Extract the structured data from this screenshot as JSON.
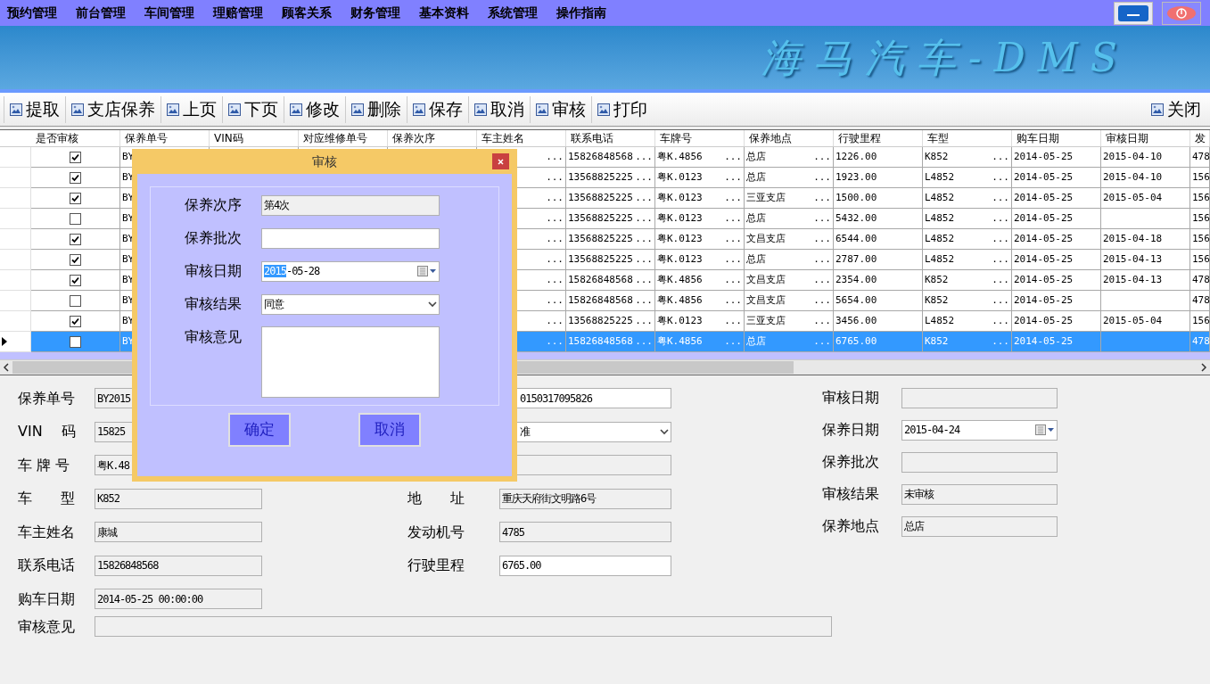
{
  "menu": [
    {
      "label": "预约管理"
    },
    {
      "label": "前台管理"
    },
    {
      "label": "车间管理"
    },
    {
      "label": "理赔管理"
    },
    {
      "label": "顾客关系"
    },
    {
      "label": "财务管理"
    },
    {
      "label": "基本资料"
    },
    {
      "label": "系统管理"
    },
    {
      "label": "操作指南"
    }
  ],
  "banner": {
    "logo": "海马汽车-DMS"
  },
  "toolbar": {
    "left": [
      {
        "label": "提取"
      },
      {
        "label": "支店保养"
      },
      {
        "label": "上页"
      },
      {
        "label": "下页"
      },
      {
        "label": "修改"
      },
      {
        "label": "删除"
      },
      {
        "label": "保存"
      },
      {
        "label": "取消"
      },
      {
        "label": "审核"
      },
      {
        "label": "打印"
      }
    ],
    "right": [
      {
        "label": "关闭"
      }
    ]
  },
  "grid": {
    "columns": [
      {
        "label": "是否审核"
      },
      {
        "label": "保养单号"
      },
      {
        "label": "VIN码"
      },
      {
        "label": "对应维修单号"
      },
      {
        "label": "保养次序"
      },
      {
        "label": "车主姓名"
      },
      {
        "label": "联系电话"
      },
      {
        "label": "车牌号"
      },
      {
        "label": "保养地点"
      },
      {
        "label": "行驶里程"
      },
      {
        "label": "车型"
      },
      {
        "label": "购车日期"
      },
      {
        "label": "审核日期"
      },
      {
        "label": "发"
      }
    ],
    "rows": [
      {
        "selected": false,
        "checked": true,
        "order_no": "BY",
        "owner": {
          "button": "..."
        },
        "phone": {
          "text": "15826848568",
          "button": "..."
        },
        "plate": {
          "text": "粤K.4856",
          "button": "..."
        },
        "location": {
          "text": "总店",
          "button": "..."
        },
        "mileage": "1226.00",
        "model": {
          "text": "K852",
          "button": "..."
        },
        "buy_date": "2014-05-25",
        "audit_date": "2015-04-10",
        "engine": "478"
      },
      {
        "selected": false,
        "checked": true,
        "order_no": "BY",
        "owner": {
          "button": "..."
        },
        "phone": {
          "text": "13568825225",
          "button": "..."
        },
        "plate": {
          "text": "粤K.0123",
          "button": "..."
        },
        "location": {
          "text": "总店",
          "button": "..."
        },
        "mileage": "1923.00",
        "model": {
          "text": "L4852",
          "button": "..."
        },
        "buy_date": "2014-05-25",
        "audit_date": "2015-04-10",
        "engine": "156"
      },
      {
        "selected": false,
        "checked": true,
        "order_no": "BY",
        "owner": {
          "button": "..."
        },
        "phone": {
          "text": "13568825225",
          "button": "..."
        },
        "plate": {
          "text": "粤K.0123",
          "button": "..."
        },
        "location": {
          "text": "三亚支店",
          "button": "..."
        },
        "mileage": "1500.00",
        "model": {
          "text": "L4852",
          "button": "..."
        },
        "buy_date": "2014-05-25",
        "audit_date": "2015-05-04",
        "engine": "156"
      },
      {
        "selected": false,
        "checked": false,
        "order_no": "BY",
        "owner": {
          "button": "..."
        },
        "phone": {
          "text": "13568825225",
          "button": "..."
        },
        "plate": {
          "text": "粤K.0123",
          "button": "..."
        },
        "location": {
          "text": "总店",
          "button": "..."
        },
        "mileage": "5432.00",
        "model": {
          "text": "L4852",
          "button": "..."
        },
        "buy_date": "2014-05-25",
        "engine": "156"
      },
      {
        "selected": false,
        "checked": true,
        "order_no": "BY",
        "owner": {
          "button": "..."
        },
        "phone": {
          "text": "13568825225",
          "button": "..."
        },
        "plate": {
          "text": "粤K.0123",
          "button": "..."
        },
        "location": {
          "text": "文昌支店",
          "button": "..."
        },
        "mileage": "6544.00",
        "model": {
          "text": "L4852",
          "button": "..."
        },
        "buy_date": "2014-05-25",
        "audit_date": "2015-04-18",
        "engine": "156"
      },
      {
        "selected": false,
        "checked": true,
        "order_no": "BY",
        "owner": {
          "button": "..."
        },
        "phone": {
          "text": "13568825225",
          "button": "..."
        },
        "plate": {
          "text": "粤K.0123",
          "button": "..."
        },
        "location": {
          "text": "总店",
          "button": "..."
        },
        "mileage": "2787.00",
        "model": {
          "text": "L4852",
          "button": "..."
        },
        "buy_date": "2014-05-25",
        "audit_date": "2015-04-13",
        "engine": "156"
      },
      {
        "selected": false,
        "checked": true,
        "order_no": "BY",
        "owner": {
          "button": "..."
        },
        "phone": {
          "text": "15826848568",
          "button": "..."
        },
        "plate": {
          "text": "粤K.4856",
          "button": "..."
        },
        "location": {
          "text": "文昌支店",
          "button": "..."
        },
        "mileage": "2354.00",
        "model": {
          "text": "K852",
          "button": "..."
        },
        "buy_date": "2014-05-25",
        "audit_date": "2015-04-13",
        "engine": "478"
      },
      {
        "selected": false,
        "checked": false,
        "order_no": "BY",
        "owner": {
          "button": "..."
        },
        "phone": {
          "text": "15826848568",
          "button": "..."
        },
        "plate": {
          "text": "粤K.4856",
          "button": "..."
        },
        "location": {
          "text": "文昌支店",
          "button": "..."
        },
        "mileage": "5654.00",
        "model": {
          "text": "K852",
          "button": "..."
        },
        "buy_date": "2014-05-25",
        "engine": "478"
      },
      {
        "selected": false,
        "checked": true,
        "order_no": "BY",
        "owner": {
          "button": "..."
        },
        "phone": {
          "text": "13568825225",
          "button": "..."
        },
        "plate": {
          "text": "粤K.0123",
          "button": "..."
        },
        "location": {
          "text": "三亚支店",
          "button": "..."
        },
        "mileage": "3456.00",
        "model": {
          "text": "L4852",
          "button": "..."
        },
        "buy_date": "2014-05-25",
        "audit_date": "2015-05-04",
        "engine": "156"
      },
      {
        "selected": true,
        "checked": false,
        "order_no": "BY",
        "owner": {
          "button": "..."
        },
        "phone": {
          "text": "15826848568",
          "button": "..."
        },
        "plate": {
          "text": "粤K.4856",
          "button": "..."
        },
        "location": {
          "text": "总店",
          "button": "..."
        },
        "mileage": "6765.00",
        "model": {
          "text": "K852",
          "button": "..."
        },
        "buy_date": "2014-05-25",
        "engine": "478"
      }
    ]
  },
  "dialog": {
    "title": "审核",
    "fields": [
      {
        "label": "保养次序",
        "kind": "readonly",
        "value": "第4次"
      },
      {
        "label": "保养批次",
        "kind": "text"
      },
      {
        "label": "审核日期",
        "kind": "date",
        "selected_text": "2015",
        "value": "-05-28"
      },
      {
        "label": "审核结果",
        "kind": "select",
        "value": "同意"
      },
      {
        "label": "审核意见",
        "kind": "textarea"
      }
    ],
    "buttons": [
      {
        "label": "确定"
      },
      {
        "label": "取消"
      }
    ]
  },
  "form": {
    "left": [
      {
        "label": "保养单号",
        "kind": "readonly",
        "value": "BY2015"
      },
      {
        "label": "VIN　 码",
        "kind": "readonly",
        "value": "15825"
      },
      {
        "label": "车 牌 号",
        "kind": "readonly",
        "value": "粤K.48"
      },
      {
        "label": "车　　型",
        "kind": "readonly",
        "value": "K852"
      },
      {
        "label": "车主姓名",
        "kind": "readonly",
        "value": "康城"
      },
      {
        "label": "联系电话",
        "kind": "readonly",
        "value": "15826848568"
      },
      {
        "label": "购车日期",
        "kind": "readonly",
        "value": "2014-05-25 00:00:00"
      }
    ],
    "middle": [
      {
        "kind": "text",
        "value": "0150317095826"
      },
      {
        "kind": "select",
        "value": "准"
      },
      {
        "kind": "readonly"
      },
      {
        "label": "地　　址",
        "kind": "readonly",
        "value": "重庆天府街文明路6号"
      },
      {
        "label": "发动机号",
        "kind": "readonly",
        "value": "4785"
      },
      {
        "label": "行驶里程",
        "kind": "text",
        "value": "6765.00"
      }
    ],
    "right": [
      {
        "label": "审核日期",
        "kind": "readonly"
      },
      {
        "label": "保养日期",
        "kind": "date",
        "value": "2015-04-24"
      },
      {
        "label": "保养批次",
        "kind": "readonly"
      },
      {
        "label": "审核结果",
        "kind": "readonly",
        "value": "未审核"
      },
      {
        "label": "保养地点",
        "kind": "readonly",
        "value": "总店"
      }
    ],
    "remark": {
      "label": "审核意见",
      "kind": "readonly"
    }
  }
}
